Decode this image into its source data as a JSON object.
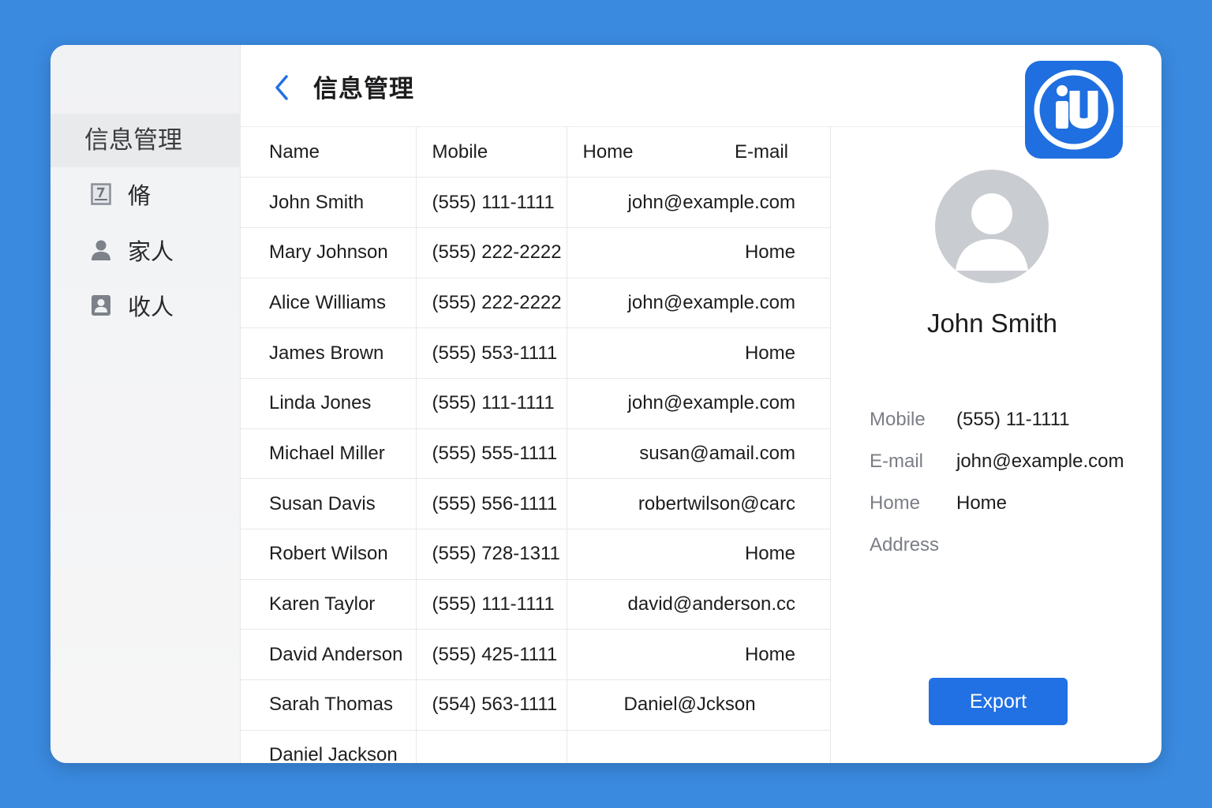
{
  "sidebar": {
    "header": "信息管理",
    "items": [
      {
        "label": "脩",
        "icon": "document-icon"
      },
      {
        "label": "家人",
        "icon": "person-icon"
      },
      {
        "label": "收人",
        "icon": "contact-card-icon"
      }
    ]
  },
  "header": {
    "title": "信息管理",
    "back_icon": "chevron-left-icon",
    "logo_icon": "app-logo-icon"
  },
  "table": {
    "columns": [
      "Name",
      "Mobile",
      "Home",
      "E-mail"
    ],
    "rows": [
      {
        "name": "John Smith",
        "mobile": "(555) 111-1111",
        "email": "john@example.com"
      },
      {
        "name": "Mary Johnson",
        "mobile": "(555) 222-2222",
        "email": "Home"
      },
      {
        "name": "Alice Williams",
        "mobile": "(555) 222-2222",
        "email": "john@example.com"
      },
      {
        "name": "James Brown",
        "mobile": "(555) 553-1111",
        "email": "Home"
      },
      {
        "name": "Linda Jones",
        "mobile": "(555) 111-1111",
        "email": "john@example.com"
      },
      {
        "name": "Michael Miller",
        "mobile": "(555) 555-1111",
        "email": "susan@amail.com"
      },
      {
        "name": "Susan Davis",
        "mobile": "(555) 556-1111",
        "email": "robertwilson@carc"
      },
      {
        "name": "Robert Wilson",
        "mobile": "(555) 728-1311",
        "email": "Home"
      },
      {
        "name": "Karen Taylor",
        "mobile": "(555) 111-1111",
        "email": "david@anderson.cc"
      },
      {
        "name": "David Anderson",
        "mobile": "(555) 425-1111",
        "email": "Home"
      },
      {
        "name": "Sarah Thomas",
        "mobile": "(554) 563-1111",
        "email": "Daniel@Jckson"
      },
      {
        "name": "Daniel Jackson",
        "mobile": "",
        "email": ""
      }
    ]
  },
  "detail": {
    "name": "John Smith",
    "avatar_icon": "avatar-placeholder-icon",
    "fields": [
      {
        "label": "Mobile",
        "value": "(555) 11-1111"
      },
      {
        "label": "E-mail",
        "value": "john@example.com"
      },
      {
        "label": "Home",
        "value": "Home"
      },
      {
        "label": "Address",
        "value": ""
      }
    ],
    "export_label": "Export"
  },
  "colors": {
    "background": "#3a8ae0",
    "accent": "#2170e4",
    "sidebar": "#f1f2f4",
    "avatar": "#c9ccd1"
  }
}
